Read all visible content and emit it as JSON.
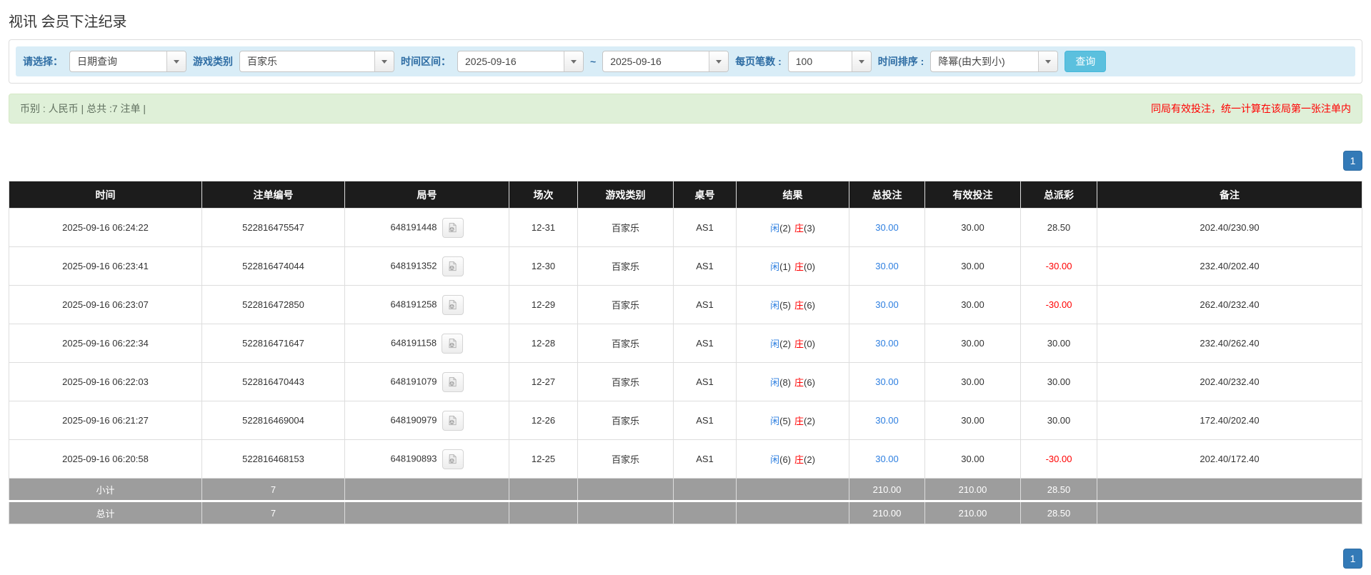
{
  "page": {
    "title": "视讯 会员下注纪录"
  },
  "filters": {
    "select_label": "请选择：",
    "select_value": "日期查询",
    "game_label": "游戏类别",
    "game_value": "百家乐",
    "range_label": "时间区间：",
    "date_from": "2025-09-16",
    "tilde": "~",
    "date_to": "2025-09-16",
    "per_page_label": "每页笔数 :",
    "per_page_value": "100",
    "sort_label": "时间排序 :",
    "sort_value": "降幂(由大到小)",
    "search_button": "查询"
  },
  "summary": {
    "left": "币别 : 人民币 | 总共 :7 注单 |",
    "right_notice": "同局有效投注，统一计算在该局第一张注单内"
  },
  "pagination": {
    "page": "1"
  },
  "colors": {
    "info_bar_bg": "#d9edf7",
    "success_bar_bg": "#dff0d8",
    "header_bg": "#1c1c1c",
    "footer_gray": "#9d9d9d",
    "accent_link_blue": "#2e7fe0",
    "pagination_blue": "#337ab7",
    "query_button_cyan": "#5bc0de",
    "negative_red": "#ff0000"
  },
  "table": {
    "headers": [
      "时间",
      "注单编号",
      "局号",
      "场次",
      "游戏类别",
      "桌号",
      "结果",
      "总投注",
      "有效投注",
      "总派彩",
      "备注"
    ],
    "rows": [
      {
        "time": "2025-09-16 06:24:22",
        "bet_id": "522816475547",
        "round_id": "648191448",
        "session": "12-31",
        "game": "百家乐",
        "table_no": "AS1",
        "player_label": "闲",
        "player_num": "(2)",
        "banker_label": "庄",
        "banker_num": "(3)",
        "total_bet": "30.00",
        "valid_bet": "30.00",
        "payout": "28.50",
        "remark": "202.40/230.90"
      },
      {
        "time": "2025-09-16 06:23:41",
        "bet_id": "522816474044",
        "round_id": "648191352",
        "session": "12-30",
        "game": "百家乐",
        "table_no": "AS1",
        "player_label": "闲",
        "player_num": "(1)",
        "banker_label": "庄",
        "banker_num": "(0)",
        "total_bet": "30.00",
        "valid_bet": "30.00",
        "payout": "-30.00",
        "remark": "232.40/202.40"
      },
      {
        "time": "2025-09-16 06:23:07",
        "bet_id": "522816472850",
        "round_id": "648191258",
        "session": "12-29",
        "game": "百家乐",
        "table_no": "AS1",
        "player_label": "闲",
        "player_num": "(5)",
        "banker_label": "庄",
        "banker_num": "(6)",
        "total_bet": "30.00",
        "valid_bet": "30.00",
        "payout": "-30.00",
        "remark": "262.40/232.40"
      },
      {
        "time": "2025-09-16 06:22:34",
        "bet_id": "522816471647",
        "round_id": "648191158",
        "session": "12-28",
        "game": "百家乐",
        "table_no": "AS1",
        "player_label": "闲",
        "player_num": "(2)",
        "banker_label": "庄",
        "banker_num": "(0)",
        "total_bet": "30.00",
        "valid_bet": "30.00",
        "payout": "30.00",
        "remark": "232.40/262.40"
      },
      {
        "time": "2025-09-16 06:22:03",
        "bet_id": "522816470443",
        "round_id": "648191079",
        "session": "12-27",
        "game": "百家乐",
        "table_no": "AS1",
        "player_label": "闲",
        "player_num": "(8)",
        "banker_label": "庄",
        "banker_num": "(6)",
        "total_bet": "30.00",
        "valid_bet": "30.00",
        "payout": "30.00",
        "remark": "202.40/232.40"
      },
      {
        "time": "2025-09-16 06:21:27",
        "bet_id": "522816469004",
        "round_id": "648190979",
        "session": "12-26",
        "game": "百家乐",
        "table_no": "AS1",
        "player_label": "闲",
        "player_num": "(5)",
        "banker_label": "庄",
        "banker_num": "(2)",
        "total_bet": "30.00",
        "valid_bet": "30.00",
        "payout": "30.00",
        "remark": "172.40/202.40"
      },
      {
        "time": "2025-09-16 06:20:58",
        "bet_id": "522816468153",
        "round_id": "648190893",
        "session": "12-25",
        "game": "百家乐",
        "table_no": "AS1",
        "player_label": "闲",
        "player_num": "(6)",
        "banker_label": "庄",
        "banker_num": "(2)",
        "total_bet": "30.00",
        "valid_bet": "30.00",
        "payout": "-30.00",
        "remark": "202.40/172.40"
      }
    ],
    "subtotal": {
      "label": "小计",
      "count": "7",
      "total_bet": "210.00",
      "valid_bet": "210.00",
      "payout": "28.50"
    },
    "total": {
      "label": "总计",
      "count": "7",
      "total_bet": "210.00",
      "valid_bet": "210.00",
      "payout": "28.50"
    }
  }
}
